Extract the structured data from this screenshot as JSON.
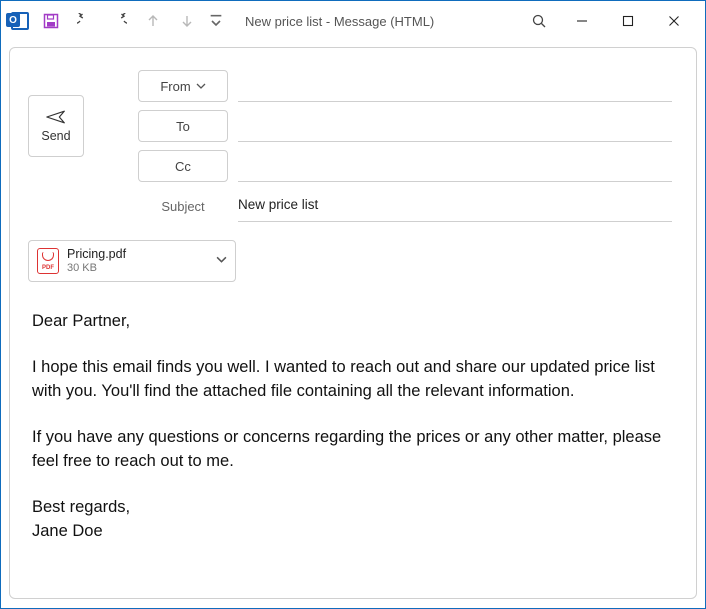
{
  "window": {
    "title": "New price list  -  Message (HTML)"
  },
  "toolbar": {
    "app_letter": "O"
  },
  "compose": {
    "send_label": "Send",
    "from_label": "From",
    "to_label": "To",
    "cc_label": "Cc",
    "subject_label": "Subject",
    "to_value": "",
    "cc_value": "",
    "subject_value": "New price list"
  },
  "attachment": {
    "filename": "Pricing.pdf",
    "size": "30 KB",
    "badge": "PDF"
  },
  "body": {
    "greeting": "Dear Partner,",
    "p1": "I hope this email finds you well. I wanted to reach out and share our updated price list with you. You'll find the attached file containing all the relevant information.",
    "p2": "If you have any questions or concerns regarding the prices or any other matter, please feel free to reach out to me.",
    "closing": "Best regards,",
    "signature": "Jane Doe"
  }
}
